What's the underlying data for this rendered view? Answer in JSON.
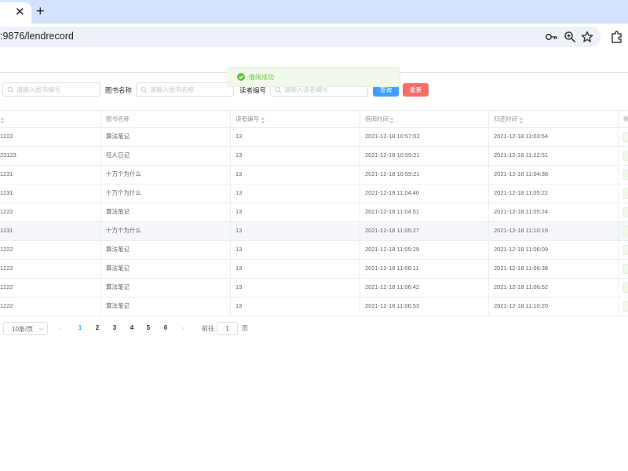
{
  "browser": {
    "tab_close_glyph": "✕",
    "new_tab_glyph": "+",
    "url": ":9876/lendrecord",
    "icons": [
      "key-icon",
      "zoom-icon",
      "star-icon",
      "extensions-icon"
    ]
  },
  "toast": {
    "message": "借阅成功",
    "icon": "success-check-icon",
    "color": "#67c23a"
  },
  "search": {
    "book_no_placeholder": "请输入图书编号",
    "book_name_label": "图书名称",
    "book_name_placeholder": "请输入图书名称",
    "reader_no_label": "读者编号",
    "reader_no_placeholder": "请输入读者编号",
    "query_button": "查询",
    "reset_button": "重置"
  },
  "table": {
    "headers": [
      "图书名称",
      "读者编号",
      "借阅时间",
      "归还时间",
      "状"
    ],
    "rows": [
      {
        "book_no": "1222",
        "book_name": "算法笔记",
        "reader_no": "13",
        "lend_time": "2021-12-18 10:57:02",
        "return_time": "2021-12-18 11:03:54"
      },
      {
        "book_no": "23123",
        "book_name": "狂人日记",
        "reader_no": "13",
        "lend_time": "2021-12-18 10:59:21",
        "return_time": "2021-12-18 11:22:51"
      },
      {
        "book_no": "1231",
        "book_name": "十万个为什么",
        "reader_no": "13",
        "lend_time": "2021-12-18 10:59:21",
        "return_time": "2021-12-18 11:04:38"
      },
      {
        "book_no": "1231",
        "book_name": "十万个为什么",
        "reader_no": "13",
        "lend_time": "2021-12-18 11:04:40",
        "return_time": "2021-12-18 11:05:22"
      },
      {
        "book_no": "1222",
        "book_name": "算法笔记",
        "reader_no": "13",
        "lend_time": "2021-12-18 11:04:51",
        "return_time": "2021-12-18 11:05:24"
      },
      {
        "book_no": "1231",
        "book_name": "十万个为什么",
        "reader_no": "13",
        "lend_time": "2021-12-18 11:05:27",
        "return_time": "2021-12-18 11:10:19"
      },
      {
        "book_no": "1222",
        "book_name": "算法笔记",
        "reader_no": "13",
        "lend_time": "2021-12-18 11:05:29",
        "return_time": "2021-12-18 11:06:09"
      },
      {
        "book_no": "1222",
        "book_name": "算法笔记",
        "reader_no": "13",
        "lend_time": "2021-12-18 11:06:11",
        "return_time": "2021-12-18 11:06:38"
      },
      {
        "book_no": "1222",
        "book_name": "算法笔记",
        "reader_no": "13",
        "lend_time": "2021-12-18 11:06:42",
        "return_time": "2021-12-18 11:06:52"
      },
      {
        "book_no": "1222",
        "book_name": "算法笔记",
        "reader_no": "13",
        "lend_time": "2021-12-18 11:06:53",
        "return_time": "2021-12-18 11:10:20"
      }
    ]
  },
  "pagination": {
    "page_size": "10条/页",
    "prev": "‹",
    "next": "›",
    "pages": [
      "1",
      "2",
      "3",
      "4",
      "5",
      "6"
    ],
    "current_page": "1",
    "goto_prefix": "前往",
    "goto_value": "1",
    "goto_suffix": "页"
  },
  "colors": {
    "primary": "#409eff",
    "danger": "#f56c6c",
    "success": "#67c23a",
    "tabbar": "#d3e3fd"
  }
}
